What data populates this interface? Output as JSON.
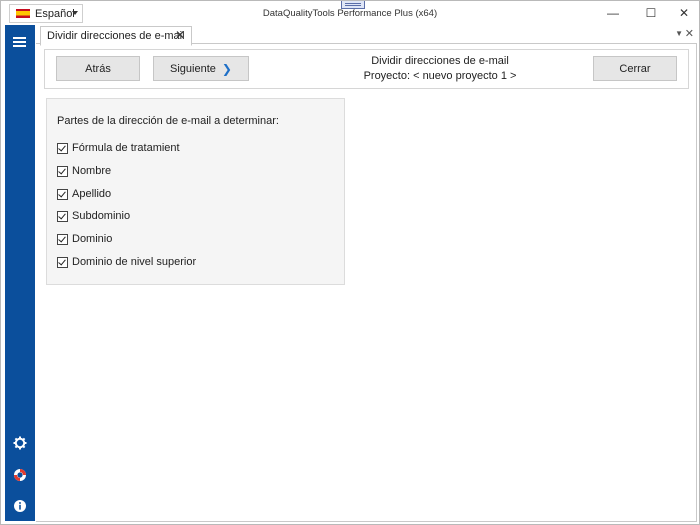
{
  "window": {
    "title": "DataQualityTools Performance Plus (x64)",
    "language": "Español",
    "minimize": "—",
    "maximize": "☐",
    "close": "✕"
  },
  "sidebar": {
    "menu_icon": "hamburger-icon",
    "bottom_icons": [
      "gear-icon",
      "lifebuoy-icon",
      "info-icon"
    ]
  },
  "tabs": [
    {
      "label": "Dividir direcciones de e-mail",
      "close": "✕"
    }
  ],
  "tabstrip": {
    "dropdown": "▼",
    "close": "✕"
  },
  "header": {
    "back_label": "Atrás",
    "next_label": "Siguiente",
    "next_arrow": "❯",
    "title": "Dividir direcciones de e-mail",
    "project": "Proyecto: < nuevo proyecto 1 >",
    "close_label": "Cerrar"
  },
  "options": {
    "title": "Partes de la dirección de e-mail a determinar:",
    "items": [
      {
        "label": "Fórmula de tratamient",
        "checked": true
      },
      {
        "label": "Nombre",
        "checked": true
      },
      {
        "label": "Apellido",
        "checked": true
      },
      {
        "label": "Subdominio",
        "checked": true
      },
      {
        "label": "Dominio",
        "checked": true
      },
      {
        "label": "Dominio de nivel superior",
        "checked": true
      }
    ]
  },
  "colors": {
    "sidebar": "#0b4f9c",
    "accent_arrow": "#1e6fc7",
    "button_bg": "#e6e6e6",
    "panel_bg": "#f5f5f5"
  }
}
